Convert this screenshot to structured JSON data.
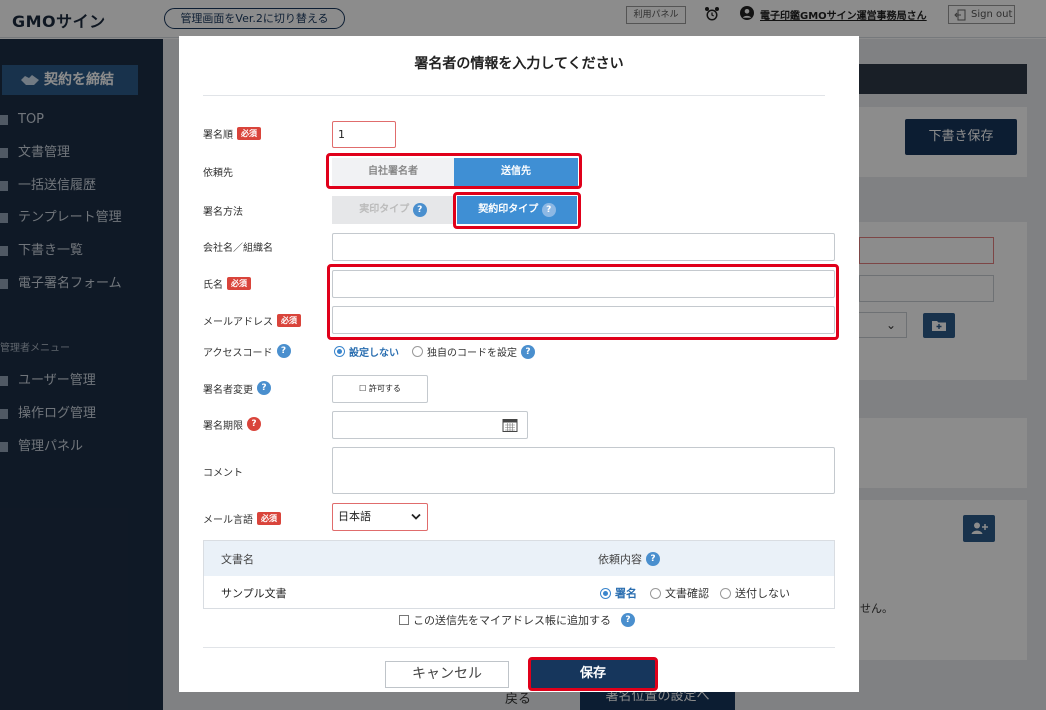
{
  "header": {
    "logo": "GMOサイン",
    "version_switch": "管理画面をVer.2に切り替える",
    "usage_panel": "利用パネル",
    "user_name": "電子印鑑GMOサイン運営事務局さん",
    "signout": "Sign out"
  },
  "sidebar": {
    "contract_button": "契約を締結",
    "items": [
      "TOP",
      "文書管理",
      "一括送信履歴",
      "テンプレート管理",
      "下書き一覧",
      "電子署名フォーム"
    ],
    "admin_heading": "管理者メニュー",
    "admin_items": [
      "ユーザー管理",
      "操作ログ管理",
      "管理パネル"
    ]
  },
  "background": {
    "draft_save": "下書き保存",
    "partial_text": "せん。",
    "back": "戻る",
    "next": "署名位置の設定へ"
  },
  "modal": {
    "title": "署名者の情報を入力してください",
    "required_badge": "必須",
    "help_glyph": "?",
    "order": {
      "label": "署名順",
      "value": "1"
    },
    "recipient": {
      "label": "依頼先",
      "options": [
        "自社署名者",
        "送信先"
      ],
      "selected": "送信先"
    },
    "method": {
      "label": "署名方法",
      "options": [
        "実印タイプ",
        "契約印タイプ"
      ],
      "selected": "契約印タイプ"
    },
    "company": {
      "label": "会社名／組織名",
      "value": ""
    },
    "name": {
      "label": "氏名",
      "value": ""
    },
    "email": {
      "label": "メールアドレス",
      "value": ""
    },
    "access_code": {
      "label": "アクセスコード",
      "options": [
        "設定しない",
        "独自のコードを設定"
      ],
      "selected": "設定しない"
    },
    "signer_change": {
      "label": "署名者変更",
      "checkbox": "☐ 許可する"
    },
    "deadline": {
      "label": "署名期限",
      "value": ""
    },
    "comment": {
      "label": "コメント",
      "value": ""
    },
    "mail_lang": {
      "label": "メール言語",
      "value": "日本語"
    },
    "table": {
      "col_doc": "文書名",
      "col_req": "依頼内容",
      "rows": [
        {
          "doc": "サンプル文書",
          "options": [
            "署名",
            "文書確認",
            "送付しない"
          ],
          "selected": "署名"
        }
      ]
    },
    "address_book": "この送信先をマイアドレス帳に追加する",
    "cancel": "キャンセル",
    "save": "保存"
  }
}
